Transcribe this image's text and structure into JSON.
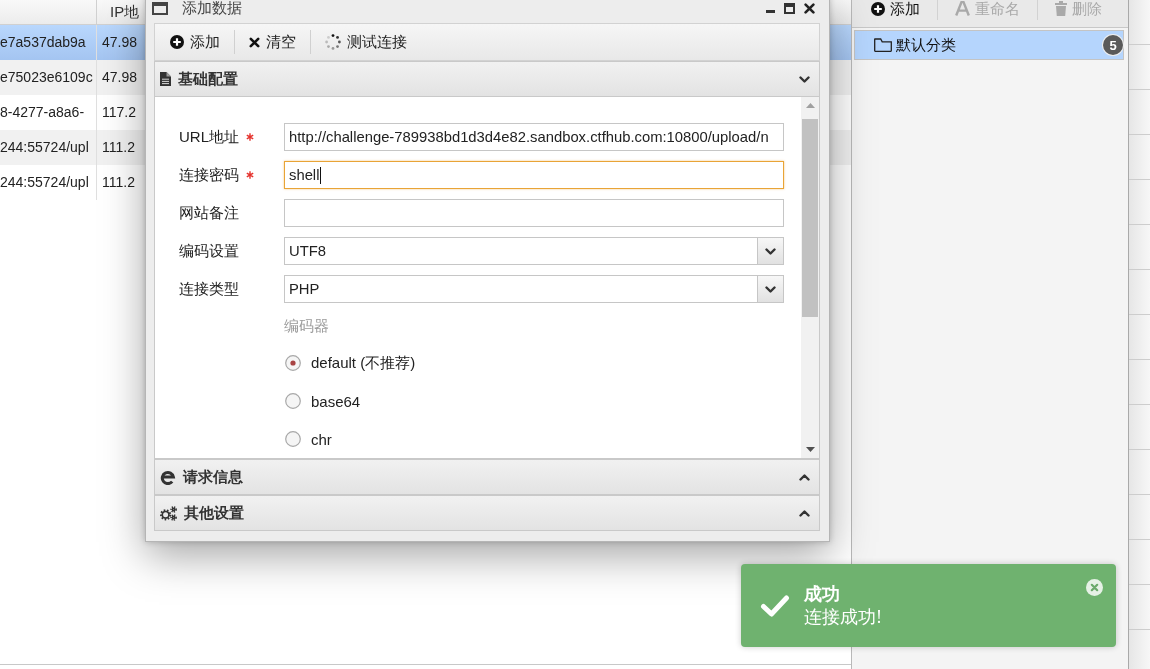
{
  "table": {
    "columns": [
      "IP地"
    ],
    "rows": [
      {
        "column_1": "e7a537dab9a",
        "column_2": "47.98",
        "selected": true
      },
      {
        "column_1": "e75023e6109c",
        "column_2": "47.98",
        "selected": false
      },
      {
        "column_1": "8-4277-a8a6-",
        "column_2": "117.2",
        "selected": false
      },
      {
        "column_1": "244:55724/upl",
        "column_2": "111.2",
        "selected": false
      },
      {
        "column_1": "244:55724/upl",
        "column_2": "111.2",
        "selected": false
      }
    ]
  },
  "dialog": {
    "title": "添加数据",
    "toolbar": [
      {
        "label": "添加"
      },
      {
        "label": "清空"
      },
      {
        "label": "测试连接"
      }
    ],
    "sections": [
      {
        "title": "基础配置",
        "expanded": true,
        "fields": [
          {
            "kind": "text",
            "label": "URL地址",
            "required": true,
            "focused": false,
            "value": "http://challenge-789938bd1d3d4e82.sandbox.ctfhub.com:10800/upload/n"
          },
          {
            "kind": "text",
            "label": "连接密码",
            "required": true,
            "focused": true,
            "value": "shell"
          },
          {
            "kind": "text",
            "label": "网站备注",
            "required": false,
            "focused": false
          },
          {
            "kind": "select",
            "label": "编码设置",
            "required": false,
            "focused": false,
            "value": "UTF8"
          },
          {
            "kind": "select",
            "label": "连接类型",
            "required": false,
            "focused": false,
            "value": "PHP"
          }
        ],
        "encoder": {
          "label": "编码器",
          "options": [
            {
              "label": "default (不推荐)",
              "selected": true
            },
            {
              "label": "base64",
              "selected": false
            },
            {
              "label": "chr",
              "selected": false
            }
          ]
        }
      },
      {
        "title": "请求信息",
        "expanded": false
      },
      {
        "title": "其他设置",
        "expanded": false
      }
    ]
  },
  "category_panel": {
    "toolbar": [
      {
        "label": "添加",
        "disabled": false
      },
      {
        "label": "重命名",
        "disabled": true
      },
      {
        "label": "删除",
        "disabled": true
      }
    ],
    "items": [
      {
        "label": "默认分类",
        "count": "5",
        "selected": true
      }
    ]
  },
  "toast": {
    "title": "成功",
    "message": "连接成功!"
  }
}
